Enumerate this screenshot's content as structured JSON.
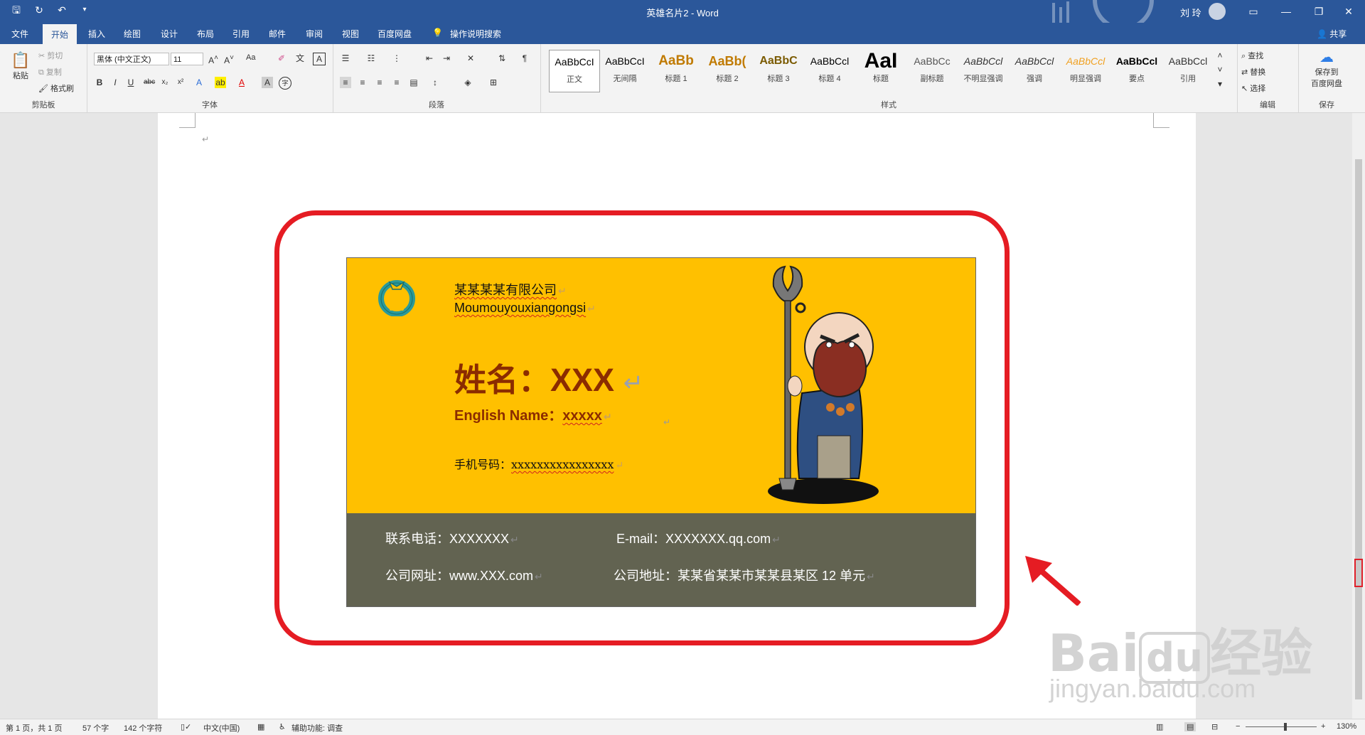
{
  "window": {
    "doc_title": "英雄名片2  -  Word",
    "user": "刘 玲"
  },
  "tabs": [
    "文件",
    "开始",
    "插入",
    "绘图",
    "设计",
    "布局",
    "引用",
    "邮件",
    "审阅",
    "视图",
    "百度网盘",
    "操作说明搜索"
  ],
  "share": "共享",
  "clipboard": {
    "paste": "粘贴",
    "cut": "剪切",
    "copy": "复制",
    "format_painter": "格式刷",
    "label": "剪贴板"
  },
  "font": {
    "name": "黑体 (中文正文)",
    "size": "11",
    "aa": "Aa",
    "label": "字体"
  },
  "paragraph": {
    "label": "段落"
  },
  "styles": {
    "label": "样式",
    "items": [
      {
        "preview": "AaBbCcI",
        "name": "正文",
        "color": "#000000"
      },
      {
        "preview": "AaBbCcI",
        "name": "无间隔",
        "color": "#000000"
      },
      {
        "preview": "AaBb",
        "name": "标题 1",
        "color": "#c07a00"
      },
      {
        "preview": "AaBb(",
        "name": "标题 2",
        "color": "#c07a00"
      },
      {
        "preview": "AaBbC",
        "name": "标题 3",
        "color": "#7a5a00"
      },
      {
        "preview": "AaBbCcl",
        "name": "标题 4",
        "color": "#000000"
      },
      {
        "preview": "AaI",
        "name": "标题",
        "color": "#000000"
      },
      {
        "preview": "AaBbCc",
        "name": "副标题",
        "color": "#555555"
      },
      {
        "preview": "AaBbCcl",
        "name": "不明显强调",
        "color": "#333333"
      },
      {
        "preview": "AaBbCcl",
        "name": "强调",
        "color": "#333333"
      },
      {
        "preview": "AaBbCcl",
        "name": "明显强调",
        "color": "#f0a020"
      },
      {
        "preview": "AaBbCcl",
        "name": "要点",
        "color": "#000000"
      },
      {
        "preview": "AaBbCcl",
        "name": "引用",
        "color": "#333333"
      }
    ]
  },
  "editing": {
    "find": "查找",
    "replace": "替换",
    "select": "选择",
    "label": "编辑"
  },
  "save": {
    "line1": "保存到",
    "line2": "百度网盘",
    "label": "保存"
  },
  "card": {
    "company_cn": "某某某某有限公司",
    "company_en": "Moumouyouxiangongsi",
    "name": "姓名：XXX",
    "english_name_label": "English Name：",
    "english_name_value": "xxxxx",
    "phone_label": "手机号码：",
    "phone_value": "xxxxxxxxxxxxxxxx",
    "tel": "联系电话：XXXXXXX",
    "email": "E-mail：XXXXXXX.qq.com",
    "website": "公司网址：www.XXX.com",
    "address": "公司地址：某某省某某市某某县某区 12 单元"
  },
  "status": {
    "page": "第 1 页，共 1 页",
    "words": "57 个字",
    "chars": "142 个字符",
    "lang": "中文(中国)",
    "access": "辅助功能: 调查",
    "zoom": "130%"
  },
  "watermark": {
    "main": "Bai",
    "du": "du",
    "jingyan": "经验",
    "url": "jingyan.baidu.com"
  }
}
